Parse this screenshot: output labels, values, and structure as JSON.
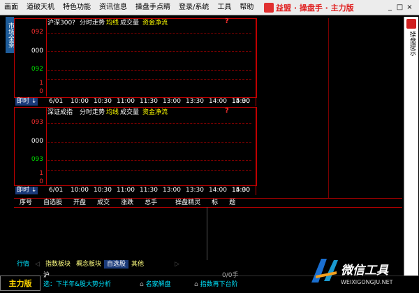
{
  "menu": [
    "画面",
    "道破天机",
    "特色功能",
    "资讯信息",
    "操盘手点睛",
    "登录/系统",
    "工具",
    "帮助"
  ],
  "app_title": "益盟 · 操盘手 · 主力版",
  "window": {
    "min": "_",
    "max": "□",
    "close": "×"
  },
  "left_tab": "市场全景",
  "right_panel": {
    "label": "操盘提示"
  },
  "chart1": {
    "title": "沪深300?",
    "subtitle_parts": [
      "分时走势",
      "均线",
      "成交量",
      "资金净流"
    ],
    "qmark": "?",
    "y_labels": [
      "092",
      "000",
      "092"
    ],
    "vol_labels": [
      "1",
      "0"
    ],
    "instant": "即时",
    "date": "6/01",
    "times": [
      "10:00",
      "10:30",
      "11:00",
      "11:30",
      "13:00",
      "13:30",
      "14:00",
      "14:30",
      "15:00"
    ]
  },
  "chart2": {
    "title": "深证成指",
    "subtitle_parts": [
      "分时走势",
      "均线",
      "成交量",
      "资金净流"
    ],
    "qmark": "?",
    "y_labels": [
      "093",
      "000",
      "093"
    ],
    "vol_labels": [
      "1",
      "0"
    ],
    "instant": "即时",
    "date": "6/01",
    "times": [
      "10:00",
      "10:30",
      "11:00",
      "11:30",
      "13:00",
      "13:30",
      "14:00",
      "14:30",
      "15:00"
    ]
  },
  "table_header": [
    "序号",
    "自选股",
    "开盘",
    "成交",
    "涨跌",
    "总手",
    "操盘精灵",
    "标",
    "题"
  ],
  "bottom_tabs": [
    "行情",
    "指数板块",
    "概念板块",
    "自选股",
    "其他"
  ],
  "status": {
    "master": "主力版",
    "market_label": "沪",
    "ratio": "0/0手",
    "ticker1": "选：下半年&股大势分析",
    "ticker2": "名家解盘",
    "ticker3": "指数再下台阶"
  },
  "watermark": {
    "brand": "微信工具",
    "url": "WEIXIGONGJU.NET"
  }
}
